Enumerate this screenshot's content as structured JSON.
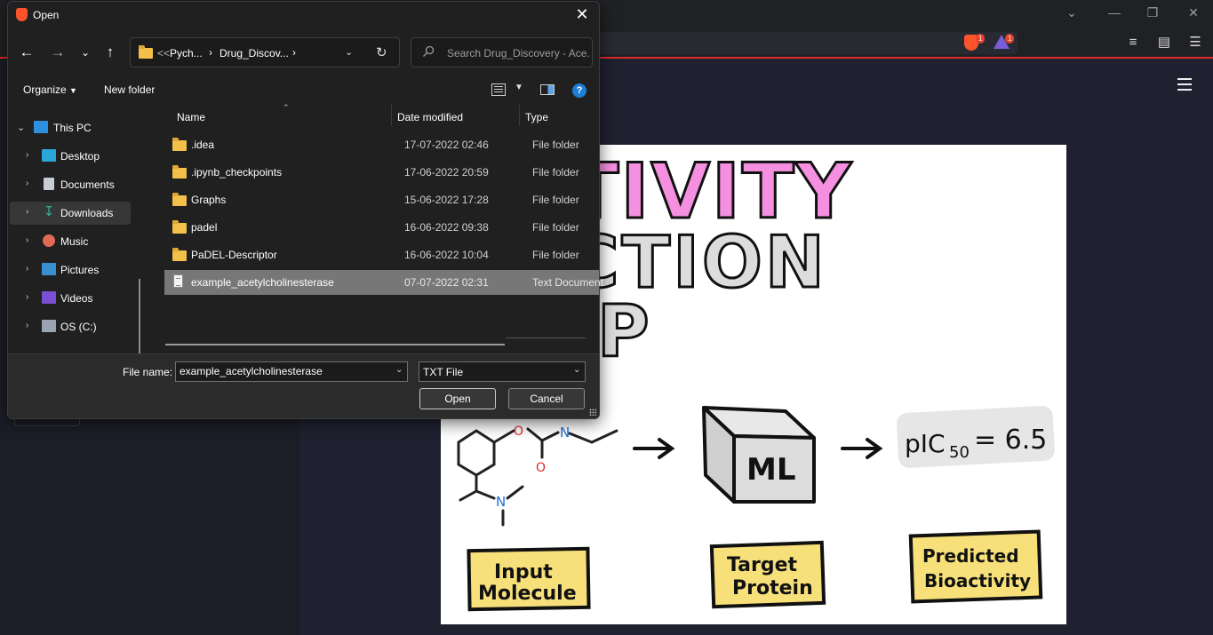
{
  "dialog": {
    "title": "Open",
    "breadcrumbs": [
      "<<",
      "Pych...",
      "Drug_Discov..."
    ],
    "search_placeholder": "Search Drug_Discovery - Ace...",
    "organize_label": "Organize",
    "new_folder_label": "New folder",
    "help_label": "?",
    "nav_items": [
      {
        "label": "This PC",
        "icon": "pc-icon",
        "selected": false
      },
      {
        "label": "Desktop",
        "icon": "desktop-icon",
        "selected": false
      },
      {
        "label": "Documents",
        "icon": "documents-icon",
        "selected": false
      },
      {
        "label": "Downloads",
        "icon": "downloads-icon",
        "selected": true
      },
      {
        "label": "Music",
        "icon": "music-icon",
        "selected": false
      },
      {
        "label": "Pictures",
        "icon": "pictures-icon",
        "selected": false
      },
      {
        "label": "Videos",
        "icon": "videos-icon",
        "selected": false
      },
      {
        "label": "OS (C:)",
        "icon": "drive-icon",
        "selected": false
      }
    ],
    "columns": {
      "name": "Name",
      "date": "Date modified",
      "type": "Type"
    },
    "files": [
      {
        "name": ".idea",
        "date": "17-07-2022 02:46",
        "type": "File folder",
        "kind": "folder"
      },
      {
        "name": ".ipynb_checkpoints",
        "date": "17-06-2022 20:59",
        "type": "File folder",
        "kind": "folder"
      },
      {
        "name": "Graphs",
        "date": "15-06-2022 17:28",
        "type": "File folder",
        "kind": "folder"
      },
      {
        "name": "padel",
        "date": "16-06-2022 09:38",
        "type": "File folder",
        "kind": "folder"
      },
      {
        "name": "PaDEL-Descriptor",
        "date": "16-06-2022 10:04",
        "type": "File folder",
        "kind": "folder"
      },
      {
        "name": "example_acetylcholinesterase",
        "date": "07-07-2022 02:31",
        "type": "Text Document",
        "kind": "text",
        "selected": true
      }
    ],
    "file_name_label": "File name:",
    "file_name_value": "example_acetylcholinesterase",
    "file_type_value": "TXT File",
    "open_label": "Open",
    "cancel_label": "Cancel"
  },
  "browser": {
    "brave_badge": "1",
    "alert_badge": "1"
  },
  "cover": {
    "title_line1": "ACTIVITY",
    "title_line2": "EDICTION",
    "title_line3": "P",
    "model_label": "ML",
    "result_label": "pIC50 = 6.5",
    "result_prefix": "pIC",
    "result_subscript": "50",
    "result_value": "= 6.5",
    "box1": [
      "Input",
      "Molecule"
    ],
    "box2": [
      "Target",
      "Protein"
    ],
    "box3": [
      "Predicted",
      "Bioactivity"
    ],
    "atom_n1": "N",
    "atom_n2": "N",
    "atom_o1": "O",
    "atom_o2": "O"
  },
  "colors": {
    "title_pink": "#f58fe0",
    "title_grey": "#dcdcdc",
    "box_yellow": "#f7e07a",
    "accent_red": "#e02a2a",
    "help_blue": "#1e7fd6"
  }
}
